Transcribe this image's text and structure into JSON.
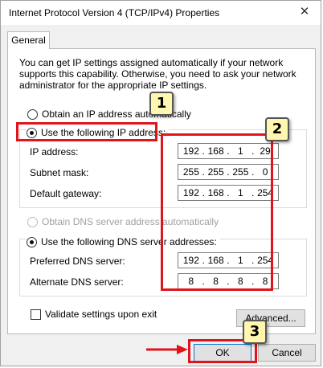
{
  "window": {
    "title": "Internet Protocol Version 4 (TCP/IPv4) Properties"
  },
  "tab": {
    "label": "General"
  },
  "intro_text": "You can get IP settings assigned automatically if your network supports this capability. Otherwise, you need to ask your network administrator for the appropriate IP settings.",
  "ip_mode": {
    "auto_label": "Obtain an IP address automatically",
    "manual_label": "Use the following IP address:",
    "selected": "manual"
  },
  "ip_fields": [
    {
      "label": "IP address:",
      "octets": [
        "192",
        "168",
        "1",
        "29"
      ]
    },
    {
      "label": "Subnet mask:",
      "octets": [
        "255",
        "255",
        "255",
        "0"
      ]
    },
    {
      "label": "Default gateway:",
      "octets": [
        "192",
        "168",
        "1",
        "254"
      ]
    }
  ],
  "dns_mode": {
    "auto_label": "Obtain DNS server address automatically",
    "manual_label": "Use the following DNS server addresses:",
    "selected": "manual"
  },
  "dns_fields": [
    {
      "label": "Preferred DNS server:",
      "octets": [
        "192",
        "168",
        "1",
        "254"
      ]
    },
    {
      "label": "Alternate DNS server:",
      "octets": [
        "8",
        "8",
        "8",
        "8"
      ]
    }
  ],
  "validate": {
    "label": "Validate settings upon exit",
    "checked": false
  },
  "buttons": {
    "advanced": "Advanced...",
    "ok": "OK",
    "cancel": "Cancel"
  },
  "annotations": {
    "step1": "1",
    "step2": "2",
    "step3": "3"
  },
  "colors": {
    "highlight": "#e0151b",
    "badge": "#fff7b0",
    "dialog_bg": "#f0f0f0"
  },
  "icons": {
    "close": "close-icon",
    "arrow": "red-arrow-icon"
  }
}
